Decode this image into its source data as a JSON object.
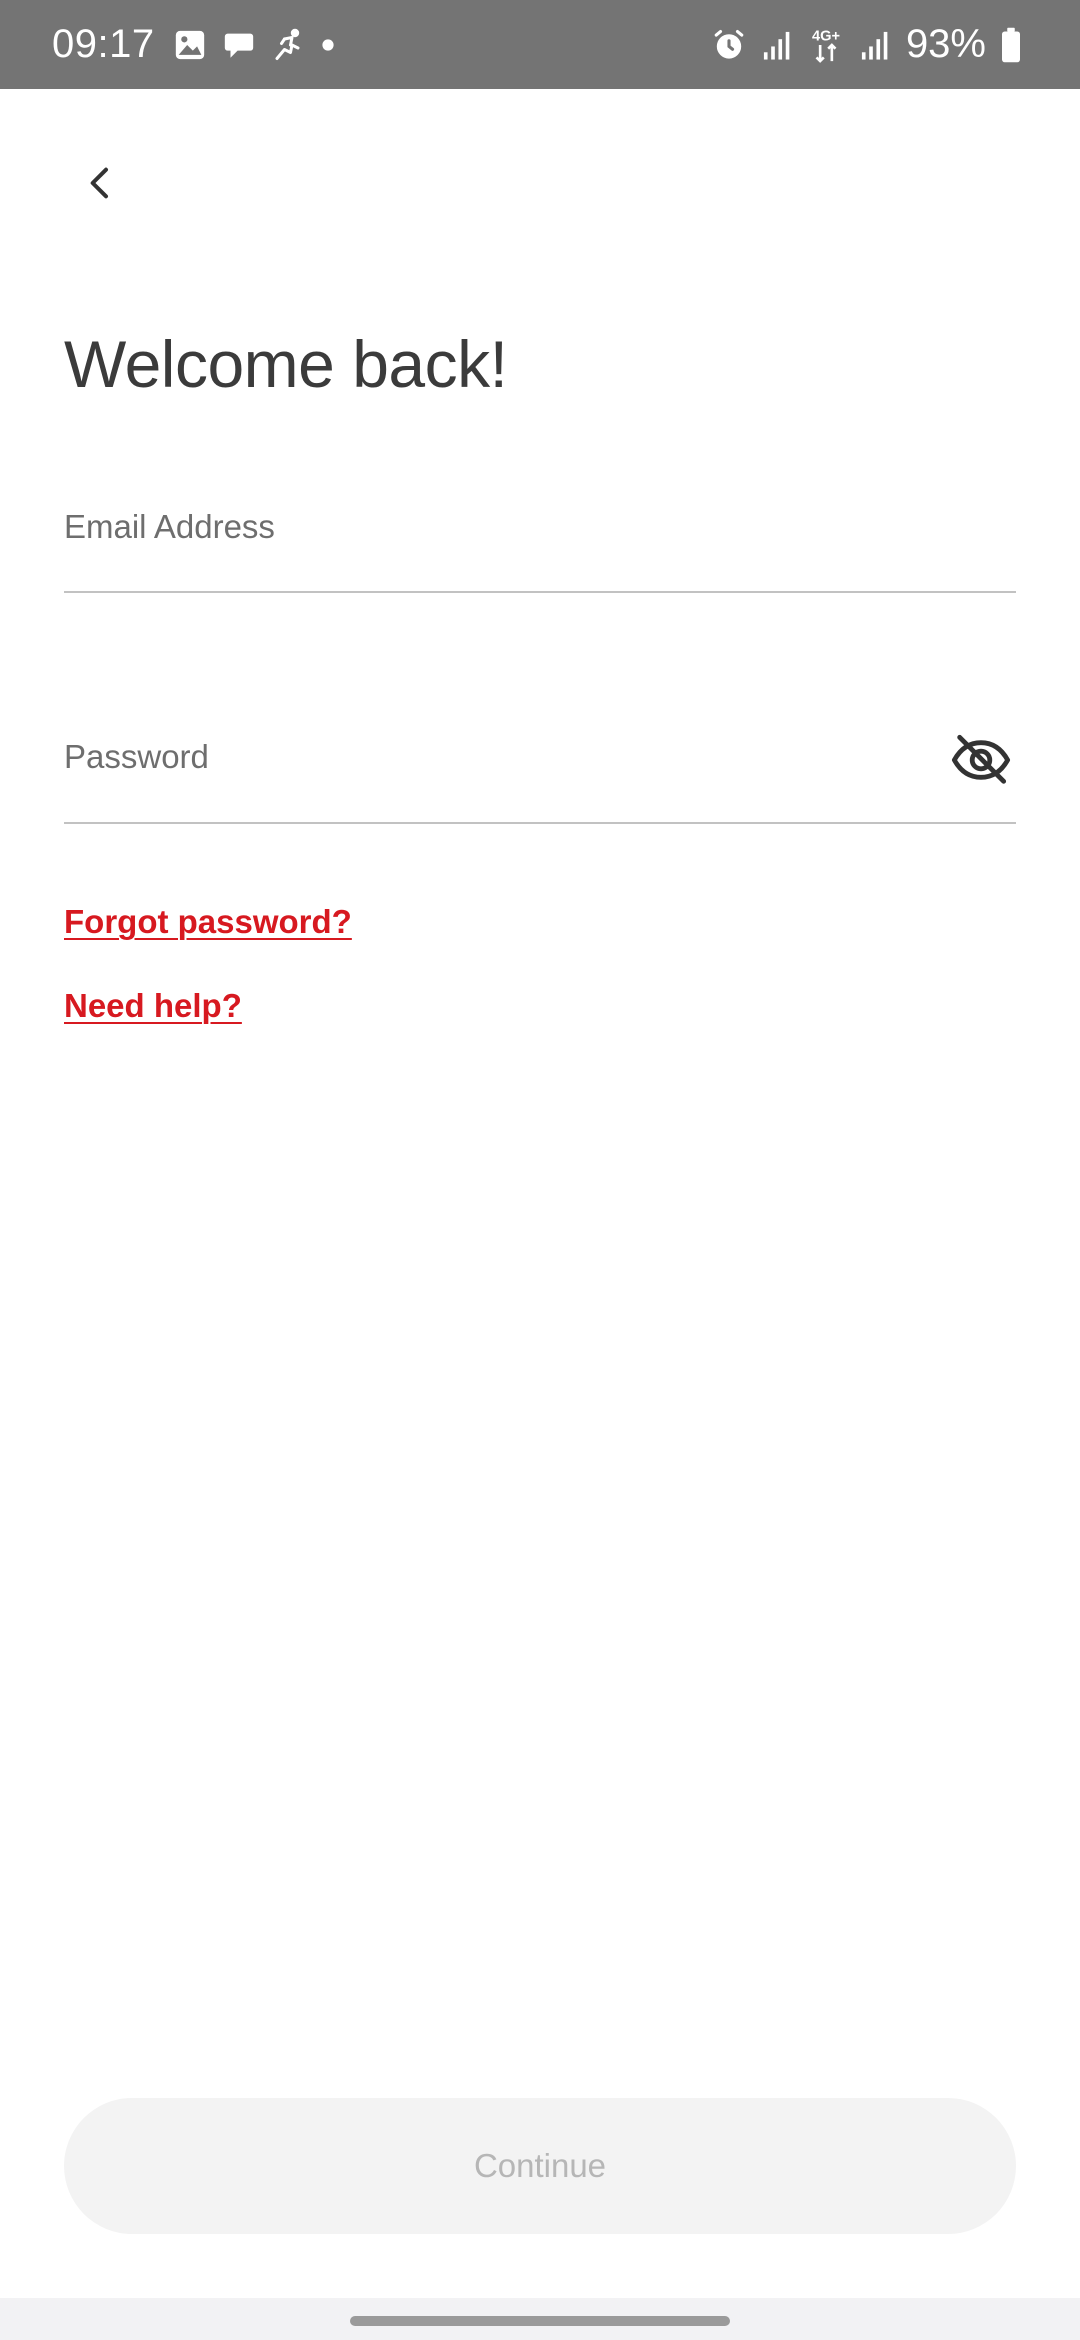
{
  "status_bar": {
    "time": "09:17",
    "network": "4G+",
    "battery": "93%",
    "left_icons": [
      "image-icon",
      "chat-bubble-icon",
      "running-icon",
      "dot-icon"
    ],
    "right_icons": [
      "alarm-icon",
      "signal-icon",
      "network-4g-icon",
      "signal-icon",
      "battery-icon"
    ]
  },
  "header": {
    "back_icon": "chevron-left-icon"
  },
  "page": {
    "title": "Welcome back!"
  },
  "form": {
    "email_placeholder": "Email Address",
    "email_value": "",
    "password_placeholder": "Password",
    "password_value": "",
    "password_toggle_icon": "eye-off-icon"
  },
  "links": {
    "forgot_password": "Forgot password?",
    "need_help": "Need help?"
  },
  "actions": {
    "continue_label": "Continue"
  },
  "colors": {
    "status_bar_bg": "#747474",
    "link": "#d71920",
    "title_text": "#3b3b3b",
    "button_disabled_bg": "#f3f3f3",
    "button_disabled_text": "#b6b6b6"
  }
}
